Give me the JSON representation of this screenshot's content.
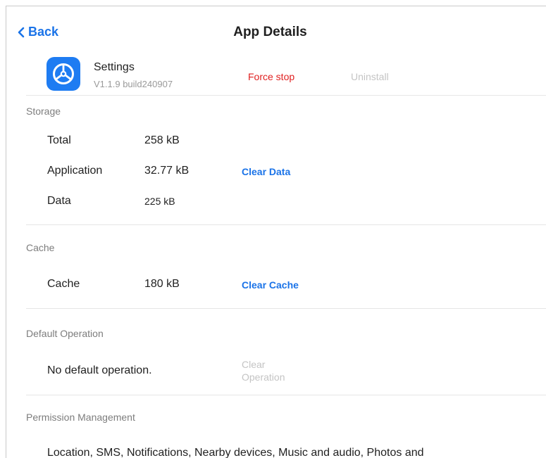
{
  "header": {
    "back_label": "Back",
    "title": "App Details"
  },
  "app": {
    "name": "Settings",
    "version": "V1.1.9 build240907",
    "icon": "steering-wheel-icon",
    "icon_color": "#1e7cf2",
    "force_stop_label": "Force stop",
    "uninstall_label": "Uninstall"
  },
  "storage": {
    "section_label": "Storage",
    "rows": [
      {
        "label": "Total",
        "value": "258 kB"
      },
      {
        "label": "Application",
        "value": "32.77 kB"
      },
      {
        "label": "Data",
        "value": "225 kB"
      }
    ],
    "clear_data_label": "Clear Data"
  },
  "cache": {
    "section_label": "Cache",
    "label": "Cache",
    "value": "180 kB",
    "clear_cache_label": "Clear Cache"
  },
  "default_operation": {
    "section_label": "Default Operation",
    "text": "No default operation.",
    "clear_operation_label": "Clear Operation"
  },
  "permissions": {
    "section_label": "Permission Management",
    "text": "Location, SMS, Notifications, Nearby devices, Music and audio, Photos and"
  },
  "colors": {
    "accent": "#1a73e8",
    "danger": "#e02020",
    "disabled": "#c4c4c4"
  }
}
